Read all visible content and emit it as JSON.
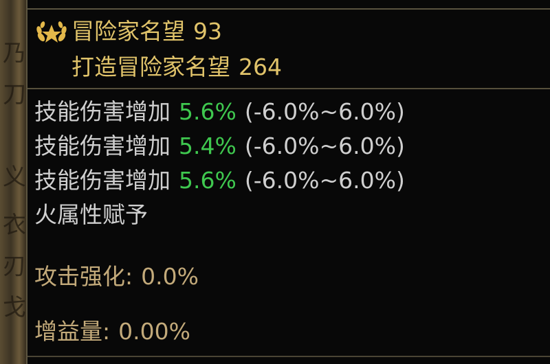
{
  "reputation": {
    "label": "冒险家名望",
    "value": "93",
    "forge_label": "打造冒险家名望",
    "forge_value": "264"
  },
  "stats": [
    {
      "label": "技能伤害增加",
      "value": "5.6%",
      "range": "(-6.0%~6.0%)"
    },
    {
      "label": "技能伤害增加",
      "value": "5.4%",
      "range": "(-6.0%~6.0%)"
    },
    {
      "label": "技能伤害增加",
      "value": "5.6%",
      "range": "(-6.0%~6.0%)"
    }
  ],
  "element_grant": "火属性赋予",
  "attack_enhance": {
    "label": "攻击强化:",
    "value": "0.0%"
  },
  "buff_amount": {
    "label": "增益量:",
    "value": "0.00%"
  },
  "colors": {
    "gold": "#e0c36a",
    "green": "#3fc84f",
    "white": "#cfcfcf",
    "tan": "#c3aa7a",
    "separator": "#56503c"
  },
  "icons": {
    "reputation": "laurel-emblem-icon"
  }
}
